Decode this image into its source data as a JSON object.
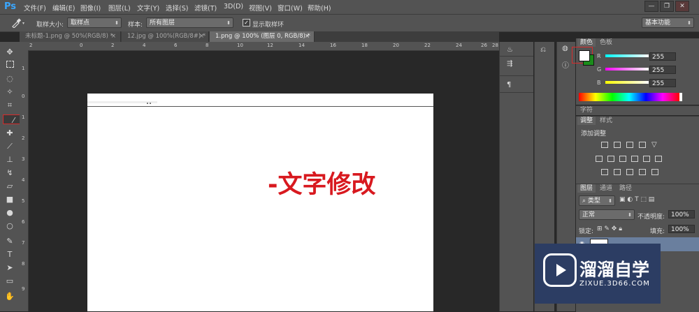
{
  "app": {
    "logo": "Ps",
    "menu": [
      "文件(F)",
      "编辑(E)",
      "图像(I)",
      "图层(L)",
      "文字(Y)",
      "选择(S)",
      "滤镜(T)",
      "3D(D)",
      "视图(V)",
      "窗口(W)",
      "帮助(H)"
    ],
    "window_controls": [
      "—",
      "❐",
      "✕"
    ]
  },
  "options_bar": {
    "tool_icon": "eyedropper-icon",
    "sample_size_label": "取样大小:",
    "sample_size_value": "取样点",
    "sample_label": "样本:",
    "sample_value": "所有图层",
    "show_ring_label": "显示取样环",
    "show_ring_checked": true,
    "workspace_value": "基本功能"
  },
  "tabs": [
    {
      "label": "未标题-1.png @ 50%(RGB/8) *",
      "active": false
    },
    {
      "label": "12.jpg @ 100%(RGB/8#) *",
      "active": false
    },
    {
      "label": "1.png @ 100% (图层 0, RGB/8) *",
      "active": true
    }
  ],
  "tab_close": "×",
  "rulers": {
    "top": [
      "2",
      "0",
      "2",
      "4",
      "6",
      "8",
      "10",
      "12",
      "14",
      "16",
      "18",
      "20",
      "22",
      "24",
      "26",
      "28"
    ],
    "left": [
      "1",
      "0",
      "1",
      "2",
      "3",
      "4",
      "5",
      "6",
      "7",
      "8",
      "9",
      "1"
    ]
  },
  "canvas": {
    "text": "-文字修改",
    "text_color": "#d8191f"
  },
  "color_panel": {
    "tabs": [
      "颜色",
      "色板"
    ],
    "channels": [
      {
        "name": "R",
        "value": "255"
      },
      {
        "name": "G",
        "value": "255"
      },
      {
        "name": "B",
        "value": "255"
      }
    ],
    "foreground": "#ffffff",
    "background": "#1b8c1b"
  },
  "char_panel": {
    "tab": "字符"
  },
  "adjust_panel": {
    "tabs": [
      "调整",
      "样式"
    ],
    "title": "添加调整"
  },
  "layers_panel": {
    "tabs": [
      "图层",
      "通道",
      "路径"
    ],
    "filter_label": "类型",
    "blend_mode": "正常",
    "opacity_label": "不透明度:",
    "opacity_value": "100%",
    "lock_label": "锁定:",
    "fill_label": "填充:",
    "fill_value": "100%"
  },
  "watermark": {
    "title": "溜溜自学",
    "url": "ZIXUE.3D66.COM"
  }
}
